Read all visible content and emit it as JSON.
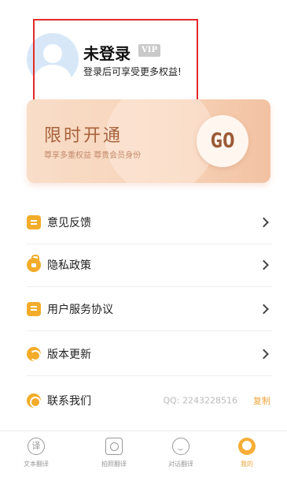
{
  "profile": {
    "name": "未登录",
    "vip_badge": "VIP",
    "tip": "登录后可享受更多权益!"
  },
  "promo": {
    "title": "限时开通",
    "subtitle": "尊享多重权益  尊贵会员身份",
    "go_label": "GO"
  },
  "menu": {
    "items": [
      {
        "label": "意见反馈",
        "icon": "feedback-icon"
      },
      {
        "label": "隐私政策",
        "icon": "privacy-lock-icon"
      },
      {
        "label": "用户服务协议",
        "icon": "agreement-doc-icon"
      },
      {
        "label": "版本更新",
        "icon": "update-refresh-icon"
      },
      {
        "label": "联系我们",
        "icon": "contact-headset-icon"
      }
    ],
    "contact_qq": "QQ: 2243228516",
    "copy_label": "复制"
  },
  "tabs": [
    {
      "label": "文本翻译",
      "icon_text": "译",
      "icon": "translate-icon"
    },
    {
      "label": "拍照翻译",
      "icon": "camera-icon"
    },
    {
      "label": "对话翻译",
      "icon": "dialog-icon"
    },
    {
      "label": "我的",
      "icon": "profile-icon",
      "active": true
    }
  ],
  "colors": {
    "accent": "#f0a43a",
    "highlight_border": "#e52929",
    "promo_text": "#a8623c"
  }
}
